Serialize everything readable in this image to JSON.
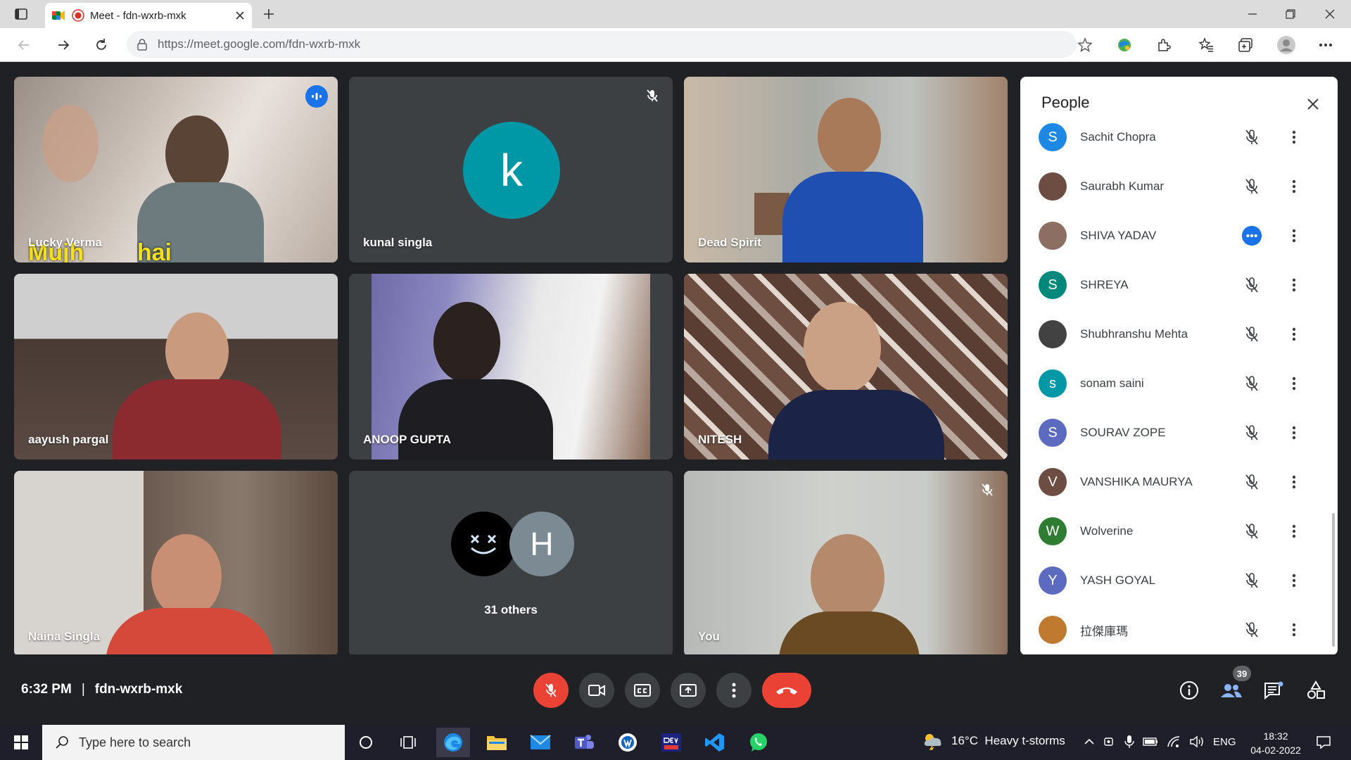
{
  "browser": {
    "tab_title": "Meet - fdn-wxrb-mxk",
    "url": "https://meet.google.com/fdn-wxrb-mxk"
  },
  "tiles": [
    {
      "name": "Lucky Verma",
      "overlay_text": "Mujh        hai"
    },
    {
      "name": "kunal singla",
      "initial": "k"
    },
    {
      "name": "Dead Spirit"
    },
    {
      "name": "aayush pargal"
    },
    {
      "name": "ANOOP GUPTA"
    },
    {
      "name": "NITESH"
    },
    {
      "name": "Naina Singla"
    },
    {
      "others_label": "31 others",
      "initial": "H"
    },
    {
      "name": "You"
    }
  ],
  "people_panel": {
    "title": "People",
    "participants": [
      {
        "name": "Sachit Chopra",
        "initial": "S",
        "color": "#1e88e5"
      },
      {
        "name": "Saurabh Kumar",
        "initial": "",
        "color": "#6d4c41"
      },
      {
        "name": "SHIVA YADAV",
        "initial": "",
        "color": "#8d6e63",
        "speaking": true
      },
      {
        "name": "SHREYA",
        "initial": "S",
        "color": "#00897b"
      },
      {
        "name": "Shubhranshu Mehta",
        "initial": "",
        "color": "#424242"
      },
      {
        "name": "sonam saini",
        "initial": "s",
        "color": "#0097a7"
      },
      {
        "name": "SOURAV ZOPE",
        "initial": "S",
        "color": "#5c6bc0"
      },
      {
        "name": "VANSHIKA MAURYA",
        "initial": "V",
        "color": "#6d4c41"
      },
      {
        "name": "Wolverine",
        "initial": "W",
        "color": "#2e7d32"
      },
      {
        "name": "YASH GOYAL",
        "initial": "Y",
        "color": "#5c6bc0"
      },
      {
        "name": "拉傑庫瑪",
        "initial": "",
        "color": "#bf7a30"
      }
    ]
  },
  "meeting": {
    "time": "6:32 PM",
    "separator": "|",
    "code": "fdn-wxrb-mxk",
    "people_count": "39"
  },
  "taskbar": {
    "search_placeholder": "Type here to search",
    "weather": "16°C  Heavy t-storms",
    "language": "ENG",
    "time": "18:32",
    "date": "04-02-2022"
  },
  "colors": {
    "accent_blue": "#1a73e8",
    "end_call_red": "#ea4335",
    "meet_bg": "#202124",
    "tile_bg": "#3c4043"
  }
}
